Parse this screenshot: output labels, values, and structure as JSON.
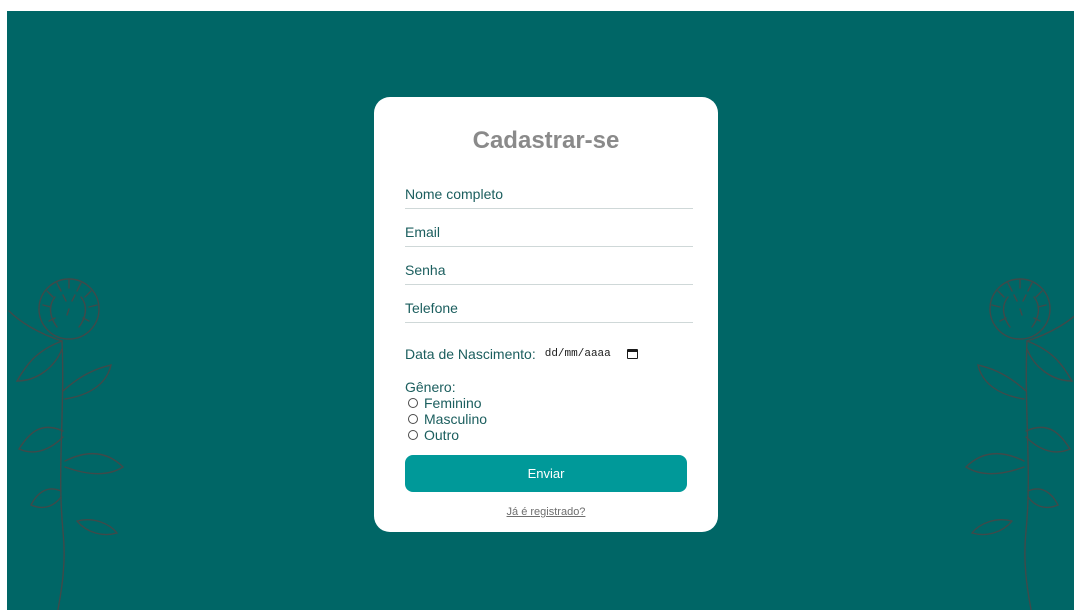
{
  "form": {
    "title": "Cadastrar-se",
    "fields": {
      "nome_placeholder": "Nome completo",
      "email_placeholder": "Email",
      "senha_placeholder": "Senha",
      "telefone_placeholder": "Telefone"
    },
    "date": {
      "label": "Data de Nascimento:",
      "value": "dd/mm/aaaa"
    },
    "gender": {
      "label": "Gênero:",
      "options": [
        "Feminino",
        "Masculino",
        "Outro"
      ]
    },
    "submit_label": "Enviar",
    "login_link": "Já é registrado?"
  },
  "colors": {
    "background": "#006666",
    "card": "#ffffff",
    "button": "#009999",
    "title": "#8a8a8a",
    "text": "#1b5e5e"
  },
  "icons": {
    "date_picker": "calendar-icon",
    "decoration": "clover-flower-icon"
  }
}
